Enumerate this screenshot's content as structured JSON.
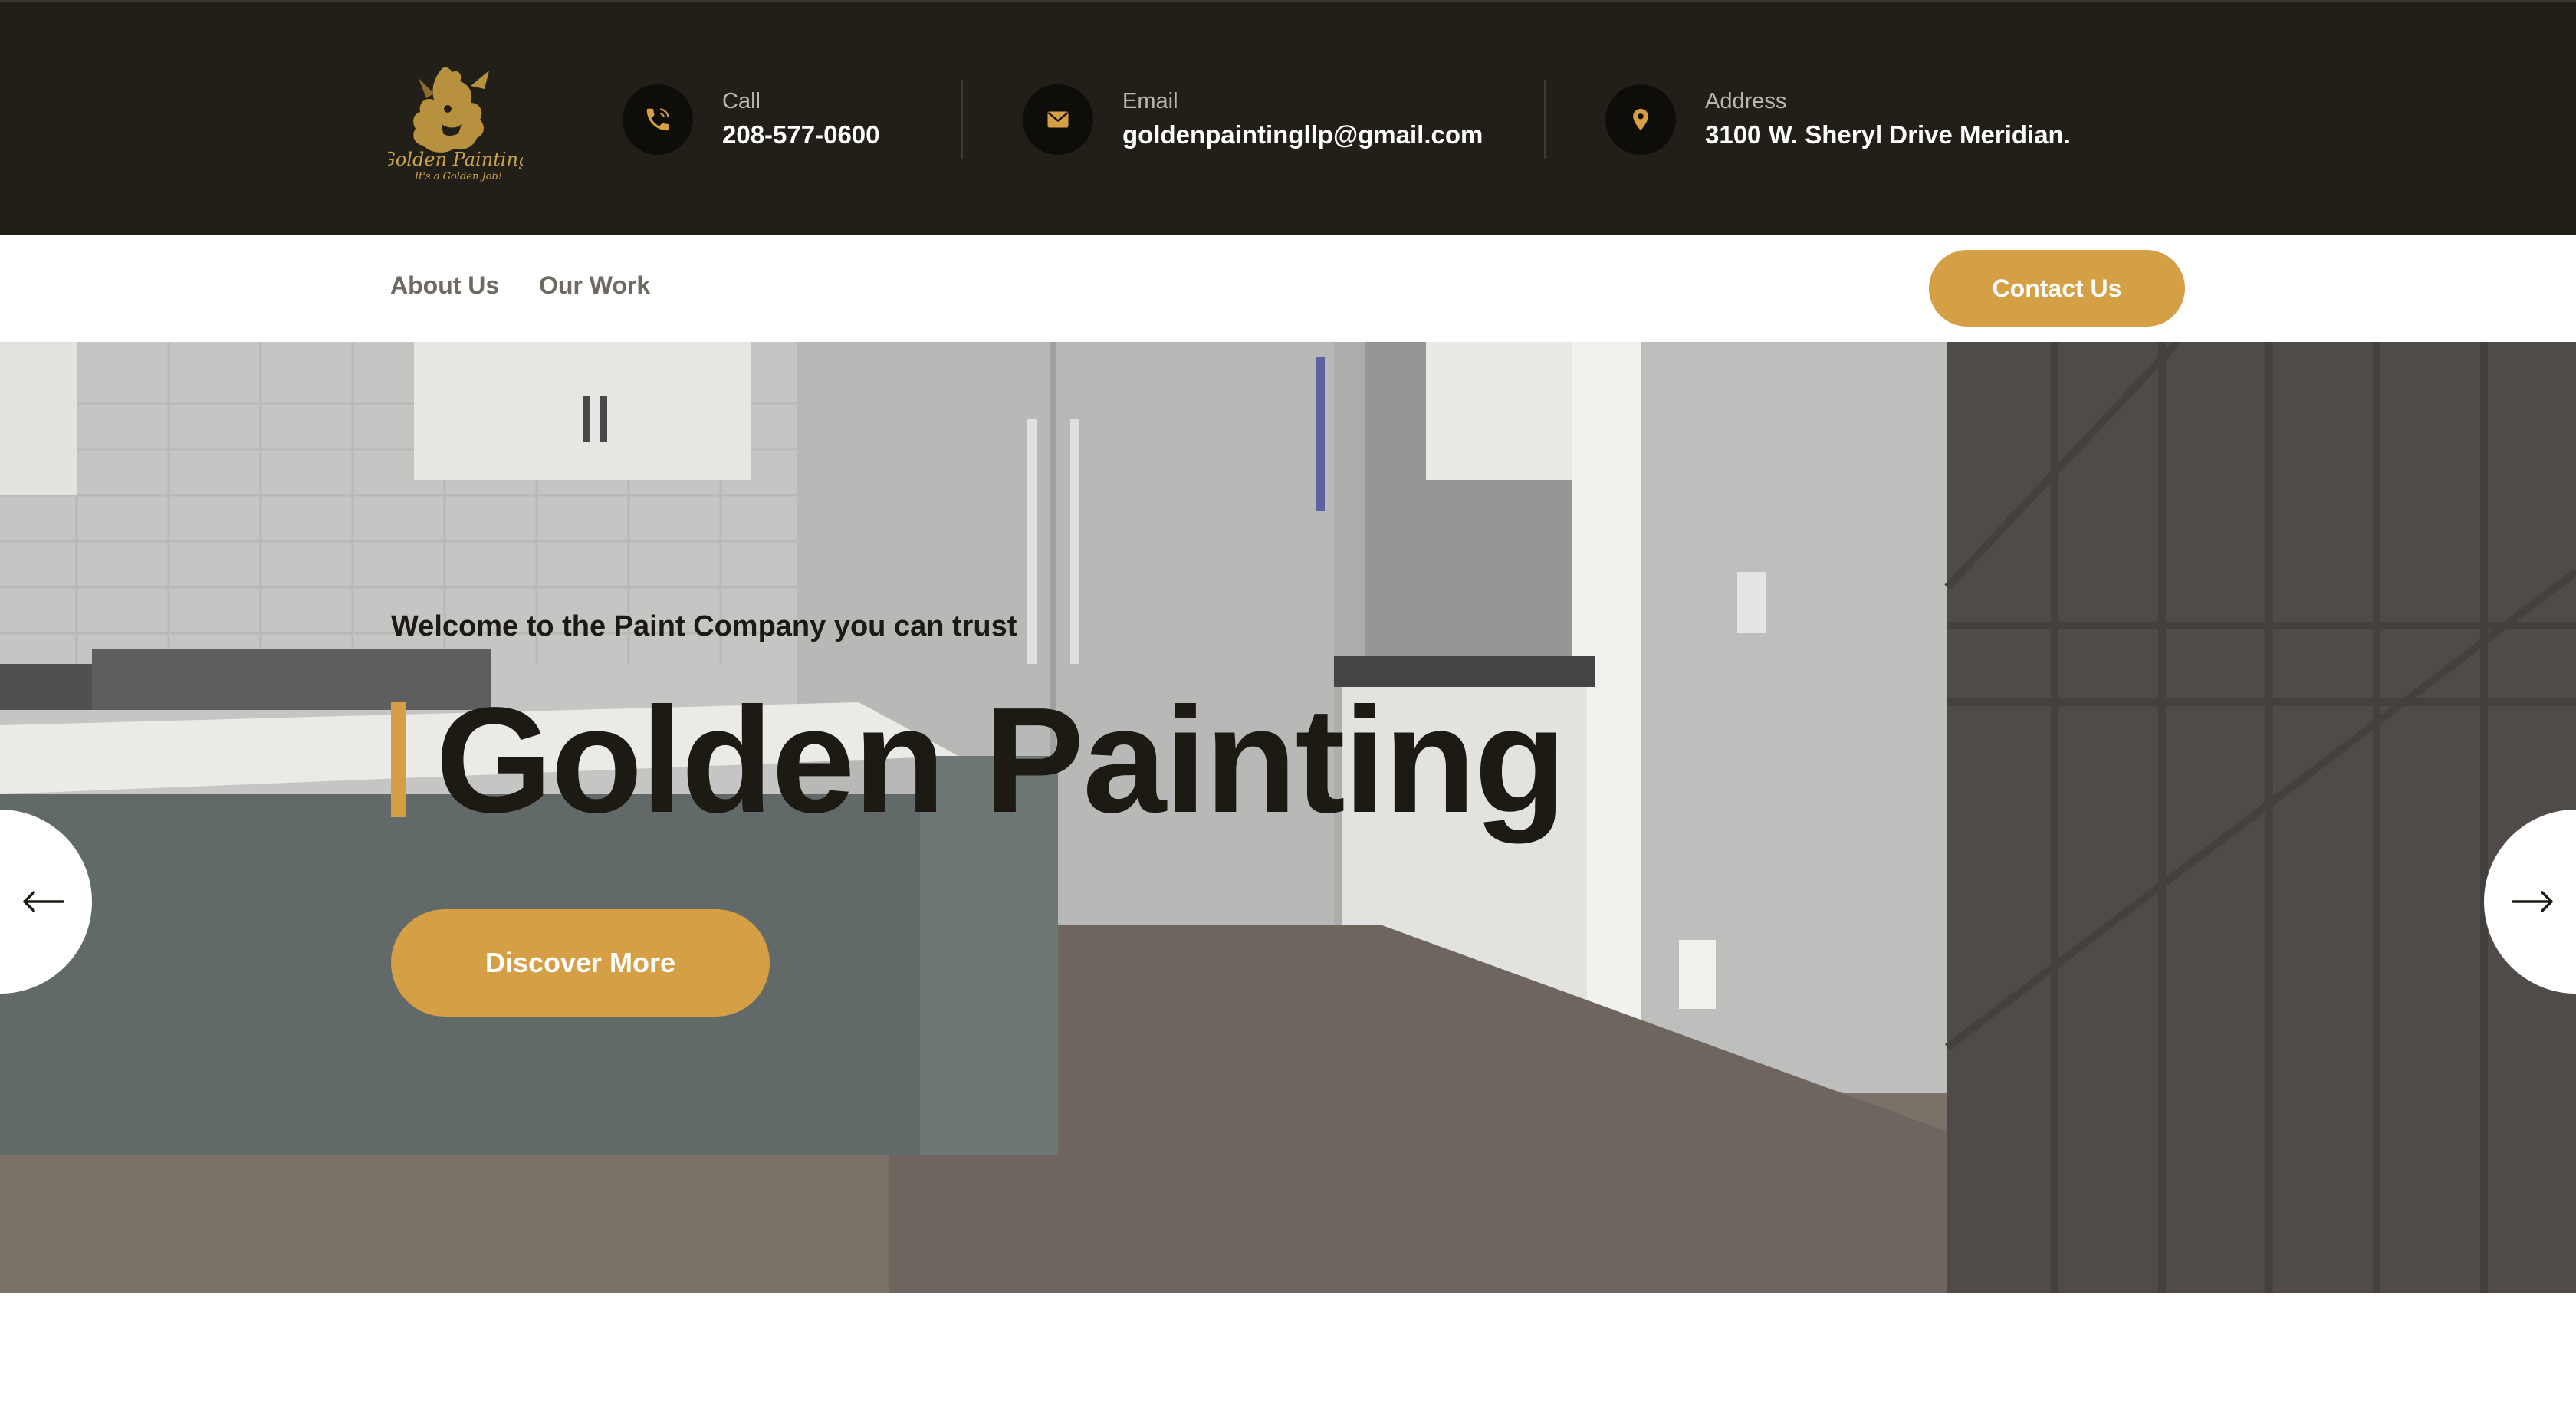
{
  "brand": {
    "logo_name": "Golden Painting",
    "logo_tagline": "It's a Golden Job!",
    "accent_color": "#d49f45",
    "dark_color": "#221f18"
  },
  "topbar": {
    "call": {
      "label": "Call",
      "value": "208-577-0600",
      "icon": "phone-icon"
    },
    "email": {
      "label": "Email",
      "value": "goldenpaintingllp@gmail.com",
      "icon": "envelope-icon"
    },
    "address": {
      "label": "Address",
      "value": "3100 W. Sheryl Drive Meridian.",
      "icon": "map-pin-icon"
    }
  },
  "nav": {
    "items": [
      {
        "label": "About Us"
      },
      {
        "label": "Our Work"
      }
    ],
    "cta_label": "Contact Us"
  },
  "hero": {
    "subtitle": "Welcome to the Paint Company you can trust",
    "title": "Golden Painting",
    "button_label": "Discover More",
    "prev_icon": "arrow-left-icon",
    "next_icon": "arrow-right-icon"
  }
}
